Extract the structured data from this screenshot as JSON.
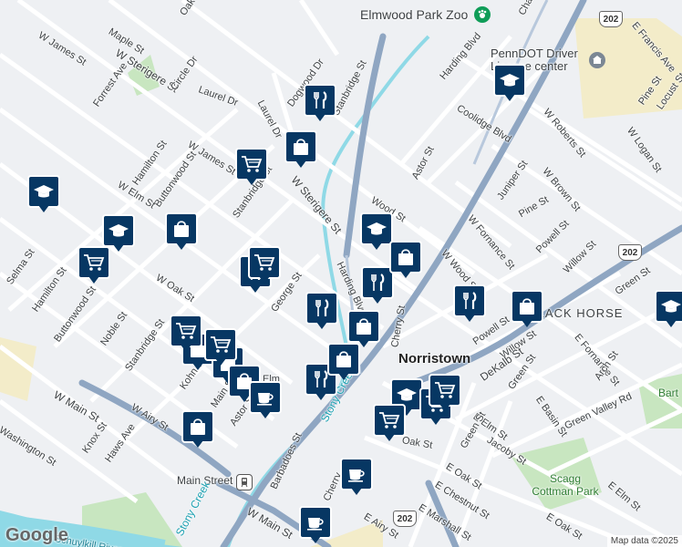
{
  "map": {
    "places": {
      "zoo": "Elmwood Park Zoo",
      "penndot": "PennDOT Driver License center",
      "town": "Norristown",
      "blackhorse": "BLACK HORSE",
      "station": "Main Street",
      "park": "Scagg Cottman Park",
      "park2": "Bart"
    },
    "water": {
      "creek1": "Stony Creek",
      "creek2": "Stony Creek",
      "river": "Schuylkill River"
    },
    "shields": {
      "s202a": "202",
      "s202b": "202",
      "s202c": "202"
    },
    "streets": {
      "maple": "Maple St",
      "oak_top": "Oak",
      "w_james_top": "W James St",
      "w_sterigere_top": "W Sterigere St",
      "forrest": "Forrest Ave",
      "circle": "Circle Dr",
      "laurel": "Laurel Dr",
      "laurel2": "Laurel Dr",
      "dogwood": "Dogwood Dr",
      "stanbridge_top": "Stanbridge St",
      "harding_top": "Harding Blvd",
      "coolidge": "Coolidge Blvd",
      "chain": "Chain",
      "w_roberts": "W Roberts St",
      "w_brown": "W Brown St",
      "francis": "E Francis Ave",
      "pine_tr": "Pine St",
      "locust": "Locust St",
      "w_logan": "W Logan St",
      "astor_top": "Astor St",
      "wood": "Wood St",
      "w_sterigere_mid": "W Sterigere St",
      "w_james_mid": "W James St",
      "hamilton_top": "Hamilton St",
      "buttonwood_top": "Buttonwood St",
      "stanbridge_mid": "Stanbridge St",
      "w_elm": "W Elm St",
      "juniper": "Juniper St",
      "pine_mid": "Pine St",
      "w_fornance": "W Fornance St",
      "w_wood": "W Wood St",
      "powell_r": "Powell St",
      "willow_r": "Willow St",
      "green_r": "Green St",
      "selma": "Selma St",
      "hamilton_l": "Hamilton St",
      "w_oak": "W Oak St",
      "george": "George St",
      "harding_mid": "Harding Blvd",
      "buttonwood_l": "Buttonwood St",
      "noble": "Noble St",
      "stanbridge_l": "Stanbridge St",
      "cherry": "Cherry St",
      "powell_c": "Powell St",
      "willow_c": "Willow St",
      "dekalb": "DeKalb St",
      "e_fornance": "E Fornance St",
      "arch": "Arch St",
      "green_c": "Green St",
      "e_basin": "E Basin St",
      "green_valley": "Green Valley Rd",
      "w_main": "W Main St",
      "kohn": "Kohn St",
      "w_airy": "W Airy St",
      "main_st": "Main St",
      "astor_low": "Astor St",
      "washington": "Washington St",
      "knox": "Knox St",
      "haws": "Haws Ave",
      "e_elm": "E Elm St",
      "jacoby": "Jacoby St",
      "green_low": "Green St",
      "e_oak": "E Oak St",
      "e_chestnut": "E Chestnut St",
      "e_marshall": "E Marshall St",
      "e_airy": "E Airy St",
      "e_oak_r": "E Oak St",
      "e_elm_r": "E Elm St",
      "barbadoes": "Barbadoes St",
      "w_main_low": "W Main St",
      "elm_mid": "Elm",
      "oak_short": "Oak St",
      "cherry_low": "Cherry"
    },
    "pins": [
      {
        "icon": "school"
      },
      {
        "icon": "school"
      },
      {
        "icon": "school"
      },
      {
        "icon": "school"
      },
      {
        "icon": "school"
      },
      {
        "icon": "school"
      },
      {
        "icon": "restaurant"
      },
      {
        "icon": "restaurant"
      },
      {
        "icon": "restaurant"
      },
      {
        "icon": "restaurant"
      },
      {
        "icon": "restaurant"
      },
      {
        "icon": "restaurant"
      },
      {
        "icon": "shopping"
      },
      {
        "icon": "shopping"
      },
      {
        "icon": "shopping"
      },
      {
        "icon": "shopping"
      },
      {
        "icon": "shopping"
      },
      {
        "icon": "shopping"
      },
      {
        "icon": "shopping"
      },
      {
        "icon": "shopping"
      },
      {
        "icon": "shopping"
      },
      {
        "icon": "shopping"
      },
      {
        "icon": "grocery"
      },
      {
        "icon": "grocery"
      },
      {
        "icon": "grocery"
      },
      {
        "icon": "grocery"
      },
      {
        "icon": "grocery"
      },
      {
        "icon": "grocery"
      },
      {
        "icon": "grocery"
      },
      {
        "icon": "grocery"
      },
      {
        "icon": "cafe"
      },
      {
        "icon": "cafe"
      },
      {
        "icon": "cafe"
      }
    ],
    "pin_color": "#073763",
    "water_color": "#8fd9e6",
    "major_road_color": "#8fa6c2",
    "park_color": "#c8e6c0"
  },
  "branding": {
    "logo": "Google",
    "attribution": "Map data ©2025"
  }
}
